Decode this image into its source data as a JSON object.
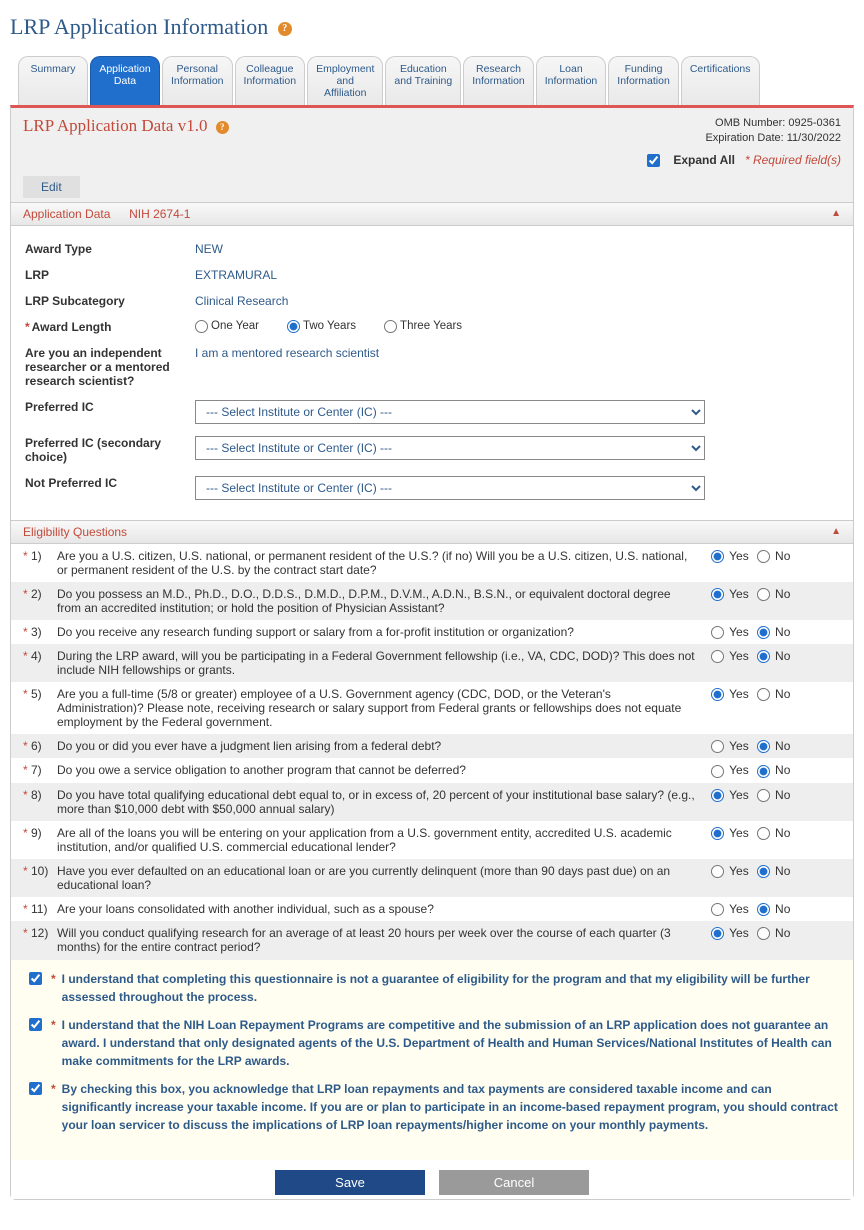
{
  "page_title": "LRP Application Information",
  "tabs": [
    {
      "l1": "Summary",
      "l2": ""
    },
    {
      "l1": "Application",
      "l2": "Data"
    },
    {
      "l1": "Personal",
      "l2": "Information"
    },
    {
      "l1": "Colleague",
      "l2": "Information"
    },
    {
      "l1": "Employment",
      "l2": "and",
      "l3": "Affiliation"
    },
    {
      "l1": "Education",
      "l2": "and Training"
    },
    {
      "l1": "Research",
      "l2": "Information"
    },
    {
      "l1": "Loan",
      "l2": "Information"
    },
    {
      "l1": "Funding",
      "l2": "Information"
    },
    {
      "l1": "Certifications",
      "l2": ""
    }
  ],
  "active_tab": 1,
  "form_title": "LRP Application Data v1.0",
  "omb_number": "OMB Number: 0925-0361",
  "expiration": "Expiration Date: 11/30/2022",
  "expand_all_label": "Expand All",
  "expand_all_checked": true,
  "required_note": "* Required field(s)",
  "edit_label": "Edit",
  "section1": {
    "title": "Application Data",
    "subhead": "NIH 2674-1"
  },
  "fields": {
    "award_type": {
      "label": "Award Type",
      "value": "NEW"
    },
    "lrp": {
      "label": "LRP",
      "value": "EXTRAMURAL"
    },
    "lrp_subcat": {
      "label": "LRP Subcategory",
      "value": "Clinical Research"
    },
    "award_length": {
      "label": "Award Length",
      "options": [
        "One Year",
        "Two Years",
        "Three Years"
      ],
      "selected": "Two Years"
    },
    "researcher": {
      "label": "Are you an independent researcher or a mentored research scientist?",
      "value": "I am a mentored research scientist"
    },
    "preferred_ic": {
      "label": "Preferred IC",
      "placeholder": "--- Select Institute or Center (IC) ---"
    },
    "preferred_ic_2": {
      "label": "Preferred IC (secondary choice)",
      "placeholder": "--- Select Institute or Center (IC) ---"
    },
    "not_preferred_ic": {
      "label": "Not Preferred IC",
      "placeholder": "--- Select Institute or Center (IC) ---"
    }
  },
  "eligibility_title": "Eligibility Questions",
  "yes_label": "Yes",
  "no_label": "No",
  "questions": [
    {
      "n": "1)",
      "txt": "Are you a U.S. citizen, U.S. national, or permanent resident of the U.S.? (if no) Will you be a U.S. citizen, U.S. national, or permanent resident of the U.S. by the contract start date?",
      "ans": "yes"
    },
    {
      "n": "2)",
      "txt": "Do you possess an M.D., Ph.D., D.O., D.D.S., D.M.D., D.P.M., D.V.M., A.D.N., B.S.N., or equivalent doctoral degree from an accredited institution; or hold the position of Physician Assistant?",
      "ans": "yes"
    },
    {
      "n": "3)",
      "txt": "Do you receive any research funding support or salary from a for-profit institution or organization?",
      "ans": "no"
    },
    {
      "n": "4)",
      "txt": "During the LRP award, will you be participating in a Federal Government fellowship (i.e., VA, CDC, DOD)? This does not include NIH fellowships or grants.",
      "ans": "no"
    },
    {
      "n": "5)",
      "txt": "Are you a full-time (5/8 or greater) employee of a U.S. Government agency (CDC, DOD, or the Veteran's Administration)? Please note, receiving research or salary support from Federal grants or fellowships does not equate employment by the Federal government.",
      "ans": "yes"
    },
    {
      "n": "6)",
      "txt": "Do you or did you ever have a judgment lien arising from a federal debt?",
      "ans": "no"
    },
    {
      "n": "7)",
      "txt": "Do you owe a service obligation to another program that cannot be deferred?",
      "ans": "no"
    },
    {
      "n": "8)",
      "txt": "Do you have total qualifying educational debt equal to, or in excess of, 20 percent of your institutional base salary? (e.g., more than $10,000 debt with $50,000 annual salary)",
      "ans": "yes"
    },
    {
      "n": "9)",
      "txt": "Are all of the loans you will be entering on your application from a U.S. government entity, accredited U.S. academic institution, and/or qualified U.S. commercial educational lender?",
      "ans": "yes"
    },
    {
      "n": "10)",
      "txt": "Have you ever defaulted on an educational loan or are you currently delinquent (more than 90 days past due) on an educational loan?",
      "ans": "no"
    },
    {
      "n": "11)",
      "txt": "Are your loans consolidated with another individual, such as a spouse?",
      "ans": "no"
    },
    {
      "n": "12)",
      "txt": "Will you conduct qualifying research for an average of at least 20 hours per week over the course of each quarter (3 months) for the entire contract period?",
      "ans": "yes"
    }
  ],
  "acks": [
    "I understand that completing this questionnaire is not a guarantee of eligibility for the program and that my eligibility will be further assessed throughout the process.",
    "I understand that the NIH Loan Repayment Programs are competitive and the submission of an LRP application does not guarantee an award. I understand that only designated agents of the U.S. Department of Health and Human Services/National Institutes of Health can make commitments for the LRP awards.",
    "By checking this box, you acknowledge that LRP loan repayments and tax payments are considered taxable income and can significantly increase your taxable income. If you are or plan to participate in an income-based repayment program, you should contract your loan servicer to discuss the implications of LRP loan repayments/higher income on your monthly payments."
  ],
  "save_label": "Save",
  "cancel_label": "Cancel"
}
